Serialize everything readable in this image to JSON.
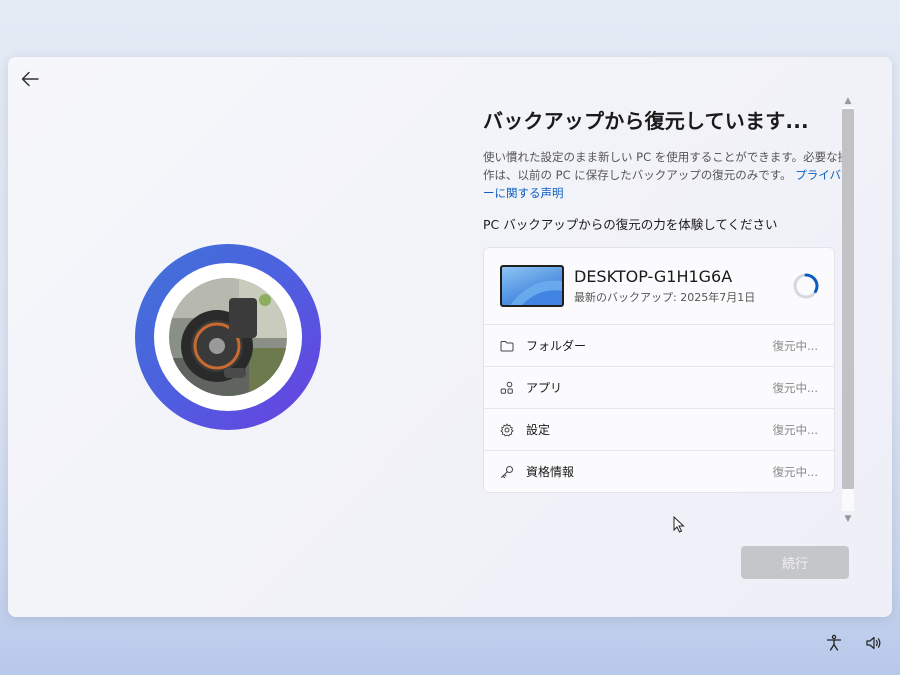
{
  "title": "バックアップから復元しています...",
  "description": {
    "text": "使い慣れた設定のまま新しい PC を使用することができます。必要な操作は、以前の PC に保存したバックアップの復元のみです。 ",
    "link": "プライバシーに関する声明"
  },
  "subheading": "PC バックアップからの復元の力を体験してください",
  "device": {
    "name": "DESKTOP-G1H1G6A",
    "last_backup": "最新のバックアップ: 2025年7月1日"
  },
  "items": [
    {
      "label": "フォルダー",
      "status": "復元中...",
      "icon": "folder-icon"
    },
    {
      "label": "アプリ",
      "status": "復元中...",
      "icon": "apps-icon"
    },
    {
      "label": "設定",
      "status": "復元中...",
      "icon": "gear-icon"
    },
    {
      "label": "資格情報",
      "status": "復元中...",
      "icon": "key-icon"
    }
  ],
  "next_button": "続行",
  "colors": {
    "accent": "#0a5cc2",
    "ring_start": "#3f74d6",
    "ring_end": "#6a3fe0",
    "button_disabled": "#c5c6ca"
  }
}
